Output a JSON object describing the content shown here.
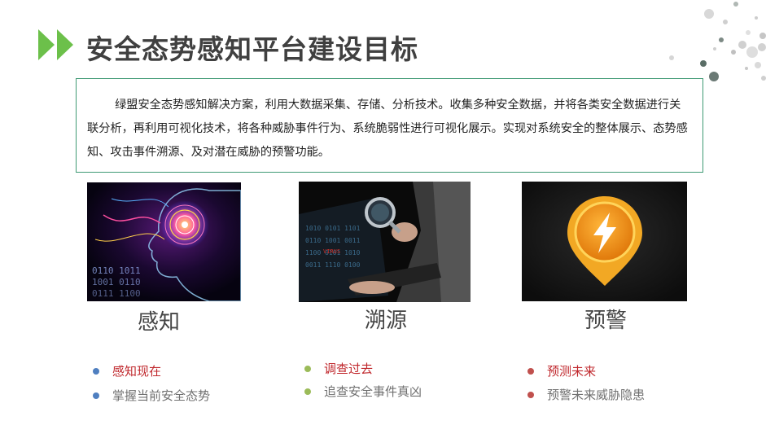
{
  "header": {
    "title": "安全态势感知平台建设目标"
  },
  "intro": {
    "text": "绿盟安全态势感知解决方案，利用大数据采集、存储、分析技术。收集多种安全数据，并将各类安全数据进行关联分析，再利用可视化技术，将各种威胁事件行为、系统脆弱性进行可视化展示。实现对系统安全的整体展示、态势感知、攻击事件溯源、及对潜在威胁的预警功能。"
  },
  "columns": [
    {
      "label": "感知",
      "image": "ai-head-brain-image",
      "bullet_color": "#4f7fc0",
      "items": [
        "感知现在",
        "掌握当前安全态势"
      ]
    },
    {
      "label": "溯源",
      "image": "magnifier-laptop-image",
      "bullet_color": "#9bbb59",
      "items": [
        "调查过去",
        "追查安全事件真凶"
      ]
    },
    {
      "label": "预警",
      "image": "warning-pin-icon-image",
      "bullet_color": "#c0504d",
      "items": [
        "预测未来",
        "预警未来威胁隐患"
      ]
    }
  ],
  "colors": {
    "accent_green": "#6cc04a",
    "border_green": "#3f9a74",
    "highlight_red": "#c0282d",
    "muted_gray": "#707070"
  }
}
